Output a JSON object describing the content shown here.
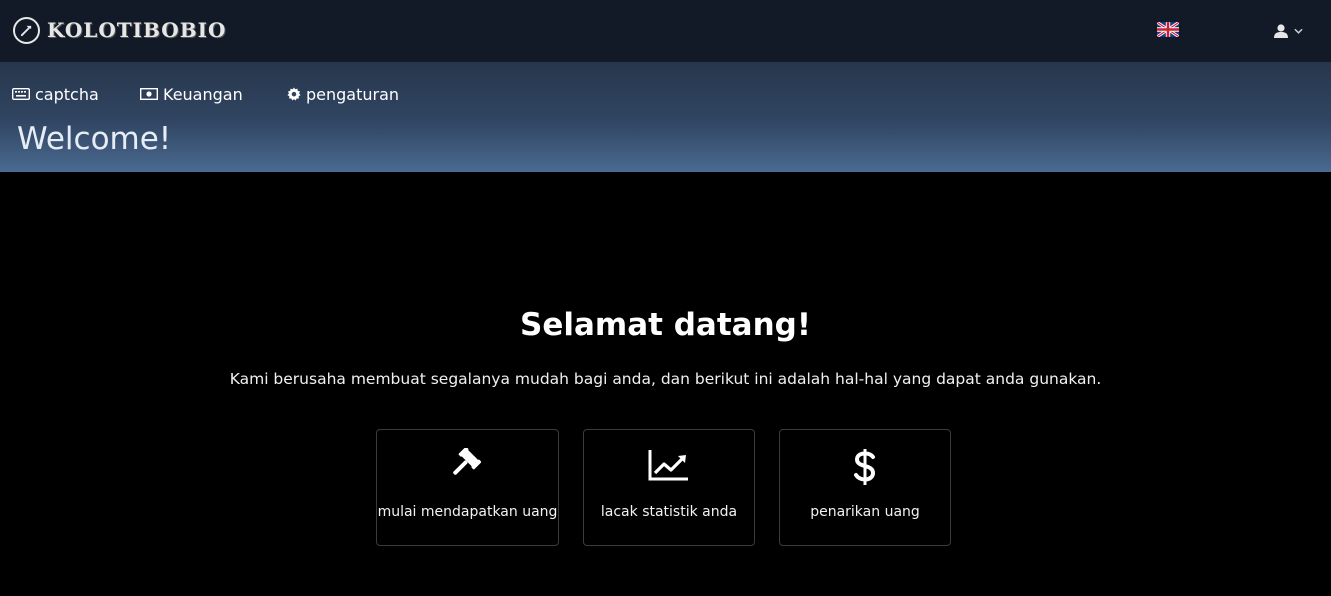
{
  "header": {
    "logo_text": "KOLOTIBOBIO",
    "logo_icon": "hammer-icon",
    "language_flag": "uk-flag-icon",
    "user_icon": "user-icon"
  },
  "nav": {
    "items": [
      {
        "label": "captcha",
        "icon": "keyboard-icon"
      },
      {
        "label": "Keuangan",
        "icon": "money-icon"
      },
      {
        "label": "pengaturan",
        "icon": "gear-icon"
      }
    ]
  },
  "banner": {
    "title": "Welcome!"
  },
  "main": {
    "title": "Selamat datang!",
    "subtitle": "Kami berusaha membuat segalanya mudah bagi anda, dan berikut ini adalah hal-hal yang dapat anda gunakan.",
    "cards": [
      {
        "label": "mulai mendapatkan uang",
        "icon": "gavel-icon"
      },
      {
        "label": "lacak statistik anda",
        "icon": "line-chart-icon"
      },
      {
        "label": "penarikan uang",
        "icon": "dollar-icon"
      }
    ]
  },
  "colors": {
    "topbar": "#121a27",
    "band_top": "#27364c",
    "band_bottom": "#4a6a91",
    "background": "#000000"
  }
}
